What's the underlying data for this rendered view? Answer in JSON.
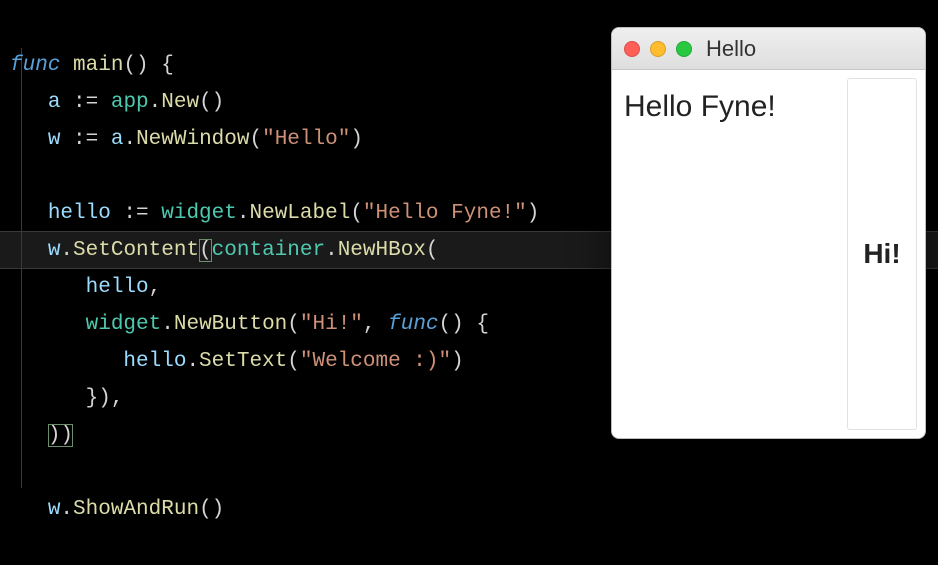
{
  "code": {
    "l1_func": "func",
    "l1_main": "main",
    "l1_rest": "() {",
    "l2_a": "a",
    "l2_assign": " := ",
    "l2_app": "app",
    "l2_dot": ".",
    "l2_New": "New",
    "l2_rest": "()",
    "l3_w": "w",
    "l3_assign": " := ",
    "l3_obj": "a",
    "l3_dot": ".",
    "l3_NewWindow": "NewWindow",
    "l3_open": "(",
    "l3_str": "\"Hello\"",
    "l3_close": ")",
    "l5_hello": "hello",
    "l5_assign": " := ",
    "l5_widget": "widget",
    "l5_dot": ".",
    "l5_NewLabel": "NewLabel",
    "l5_open": "(",
    "l5_str": "\"Hello Fyne!\"",
    "l5_close": ")",
    "l6_w": "w",
    "l6_dot": ".",
    "l6_SetContent": "SetContent",
    "l6_open": "(",
    "l6_container": "container",
    "l6_dot2": ".",
    "l6_NewHBox": "NewHBox",
    "l6_open2": "(",
    "l7_hello": "hello",
    "l7_comma": ",",
    "l8_widget": "widget",
    "l8_dot": ".",
    "l8_NewButton": "NewButton",
    "l8_open": "(",
    "l8_str": "\"Hi!\"",
    "l8_comma": ", ",
    "l8_func": "func",
    "l8_rest": "() {",
    "l9_hello": "hello",
    "l9_dot": ".",
    "l9_SetText": "SetText",
    "l9_open": "(",
    "l9_str": "\"Welcome :)\"",
    "l9_close": ")",
    "l10": "}),",
    "l11": "))",
    "l13_w": "w",
    "l13_dot": ".",
    "l13_ShowAndRun": "ShowAndRun",
    "l13_rest": "()"
  },
  "window": {
    "title": "Hello",
    "label": "Hello Fyne!",
    "button": "Hi!"
  }
}
